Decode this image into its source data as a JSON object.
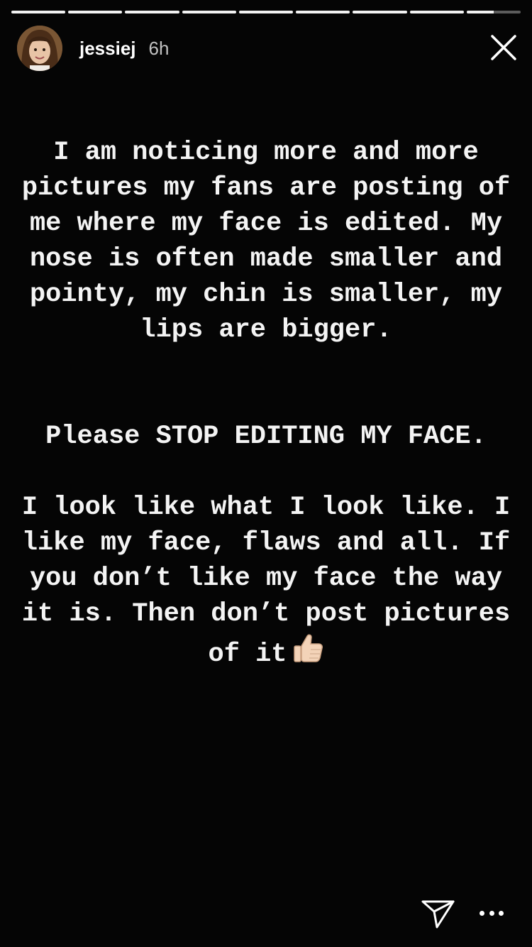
{
  "progress": {
    "segments": [
      1,
      1,
      1,
      1,
      1,
      1,
      1,
      1,
      0.5
    ]
  },
  "header": {
    "username": "jessiej",
    "timestamp": "6h"
  },
  "message": {
    "paragraph_1": "I am noticing more and more pictures my fans are posting of me where my face is edited. My nose is often made smaller and pointy, my chin is smaller, my lips are bigger.",
    "paragraph_2": "Please STOP EDITING MY FACE.",
    "paragraph_3": "I look like what I look like. I like my face, flaws and all. If you don’t like my face the way it is. Then don’t post pictures of it"
  },
  "icons": {
    "close": "close-icon",
    "send": "direct-send-icon",
    "more": "more-options-icon",
    "emoji": "thumbs-up-emoji"
  },
  "colors": {
    "background": "#050505",
    "text": "#f4f4f4"
  }
}
